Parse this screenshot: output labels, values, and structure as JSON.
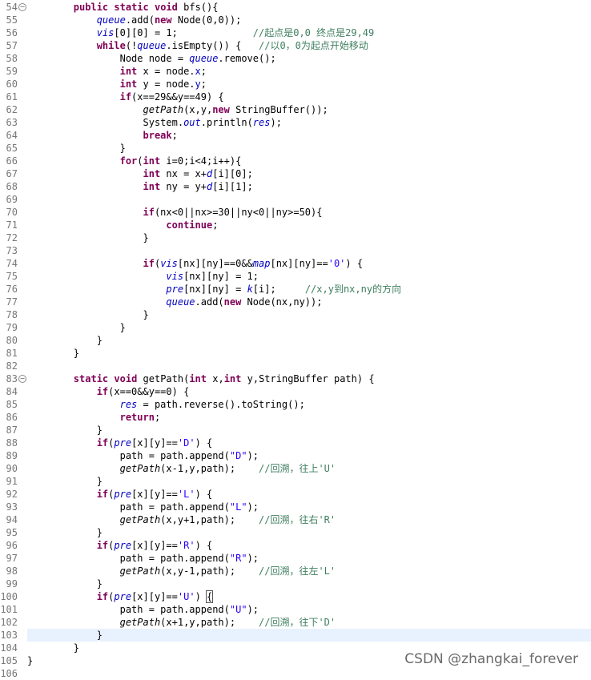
{
  "lines": [
    {
      "n": "54",
      "fold": "−",
      "t": "        <span class=\"k\">public</span> <span class=\"k\">static</span> <span class=\"k\">void</span> bfs(){"
    },
    {
      "n": "55",
      "t": "            <span class=\"f\">queue</span>.add(<span class=\"k\">new</span> Node(0,0));"
    },
    {
      "n": "56",
      "t": "            <span class=\"f\">vis</span>[0][0] = 1;             <span class=\"c\">//起点是0,0 终点是29,49</span>"
    },
    {
      "n": "57",
      "t": "            <span class=\"k\">while</span>(!<span class=\"f\">queue</span>.isEmpty()) {   <span class=\"c\">//以0，0为起点开始移动</span>"
    },
    {
      "n": "58",
      "t": "                Node node = <span class=\"f\">queue</span>.remove();"
    },
    {
      "n": "59",
      "t": "                <span class=\"k\">int</span> x = node.<span class=\"f\" style=\"font-style:normal\">x</span>;"
    },
    {
      "n": "60",
      "t": "                <span class=\"k\">int</span> y = node.<span class=\"f\" style=\"font-style:normal\">y</span>;"
    },
    {
      "n": "61",
      "t": "                <span class=\"k\">if</span>(x==29&amp;&amp;y==49) {"
    },
    {
      "n": "62",
      "t": "                    <span class=\"m\">getPath</span>(x,y,<span class=\"k\">new</span> StringBuffer());"
    },
    {
      "n": "63",
      "t": "                    System.<span class=\"f\">out</span>.println(<span class=\"f\">res</span>);"
    },
    {
      "n": "64",
      "t": "                    <span class=\"k\">break</span>;"
    },
    {
      "n": "65",
      "t": "                }"
    },
    {
      "n": "66",
      "t": "                <span class=\"k\">for</span>(<span class=\"k\">int</span> i=0;i&lt;4;i++){"
    },
    {
      "n": "67",
      "t": "                    <span class=\"k\">int</span> nx = x+<span class=\"f\">d</span>[i][0];"
    },
    {
      "n": "68",
      "t": "                    <span class=\"k\">int</span> ny = y+<span class=\"f\">d</span>[i][1];"
    },
    {
      "n": "69",
      "t": ""
    },
    {
      "n": "70",
      "t": "                    <span class=\"k\">if</span>(nx&lt;0||nx&gt;=30||ny&lt;0||ny&gt;=50){"
    },
    {
      "n": "71",
      "t": "                        <span class=\"k\">continue</span>;"
    },
    {
      "n": "72",
      "t": "                    }"
    },
    {
      "n": "73",
      "t": ""
    },
    {
      "n": "74",
      "t": "                    <span class=\"k\">if</span>(<span class=\"f\">vis</span>[nx][ny]==0&amp;&amp;<span class=\"f\">map</span>[nx][ny]==<span class=\"s\">'0'</span>) {"
    },
    {
      "n": "75",
      "t": "                        <span class=\"f\">vis</span>[nx][ny] = 1;"
    },
    {
      "n": "76",
      "t": "                        <span class=\"f\">pre</span>[nx][ny] = <span class=\"f\">k</span>[i];     <span class=\"c\">//x,y到nx,ny的方向</span>"
    },
    {
      "n": "77",
      "t": "                        <span class=\"f\">queue</span>.add(<span class=\"k\">new</span> Node(nx,ny));"
    },
    {
      "n": "78",
      "t": "                    }"
    },
    {
      "n": "79",
      "t": "                }"
    },
    {
      "n": "80",
      "t": "            }"
    },
    {
      "n": "81",
      "t": "        }"
    },
    {
      "n": "82",
      "t": ""
    },
    {
      "n": "83",
      "fold": "−",
      "t": "        <span class=\"k\">static</span> <span class=\"k\">void</span> getPath(<span class=\"k\">int</span> x,<span class=\"k\">int</span> y,StringBuffer path) {"
    },
    {
      "n": "84",
      "t": "            <span class=\"k\">if</span>(x==0&amp;&amp;y==0) {"
    },
    {
      "n": "85",
      "t": "                <span class=\"f\">res</span> = path.reverse().toString();"
    },
    {
      "n": "86",
      "t": "                <span class=\"k\">return</span>;"
    },
    {
      "n": "87",
      "t": "            }"
    },
    {
      "n": "88",
      "t": "            <span class=\"k\">if</span>(<span class=\"f\">pre</span>[x][y]==<span class=\"s\">'D'</span>) {"
    },
    {
      "n": "89",
      "t": "                path = path.append(<span class=\"s\">\"D\"</span>);"
    },
    {
      "n": "90",
      "t": "                <span class=\"m\">getPath</span>(x-1,y,path);    <span class=\"c\">//回溯，往上'U'</span>"
    },
    {
      "n": "91",
      "t": "            }"
    },
    {
      "n": "92",
      "t": "            <span class=\"k\">if</span>(<span class=\"f\">pre</span>[x][y]==<span class=\"s\">'L'</span>) {"
    },
    {
      "n": "93",
      "t": "                path = path.append(<span class=\"s\">\"L\"</span>);"
    },
    {
      "n": "94",
      "t": "                <span class=\"m\">getPath</span>(x,y+1,path);    <span class=\"c\">//回溯，往右'R'</span>"
    },
    {
      "n": "95",
      "t": "            }"
    },
    {
      "n": "96",
      "t": "            <span class=\"k\">if</span>(<span class=\"f\">pre</span>[x][y]==<span class=\"s\">'R'</span>) {"
    },
    {
      "n": "97",
      "t": "                path = path.append(<span class=\"s\">\"R\"</span>);"
    },
    {
      "n": "98",
      "t": "                <span class=\"m\">getPath</span>(x,y-1,path);    <span class=\"c\">//回溯，往左'L'</span>"
    },
    {
      "n": "99",
      "t": "            }"
    },
    {
      "n": "100",
      "t": "            <span class=\"k\">if</span>(<span class=\"f\">pre</span>[x][y]==<span class=\"s\">'U'</span>) <span class=\"caret\">{</span>"
    },
    {
      "n": "101",
      "t": "                path = path.append(<span class=\"s\">\"U\"</span>);"
    },
    {
      "n": "102",
      "t": "                <span class=\"m\">getPath</span>(x+1,y,path);    <span class=\"c\">//回溯，往下'D'</span>"
    },
    {
      "n": "103",
      "current": true,
      "t": "            }"
    },
    {
      "n": "104",
      "t": "        }"
    },
    {
      "n": "105",
      "t": "}"
    },
    {
      "n": "106",
      "t": ""
    }
  ],
  "watermark": "CSDN @zhangkai_forever"
}
